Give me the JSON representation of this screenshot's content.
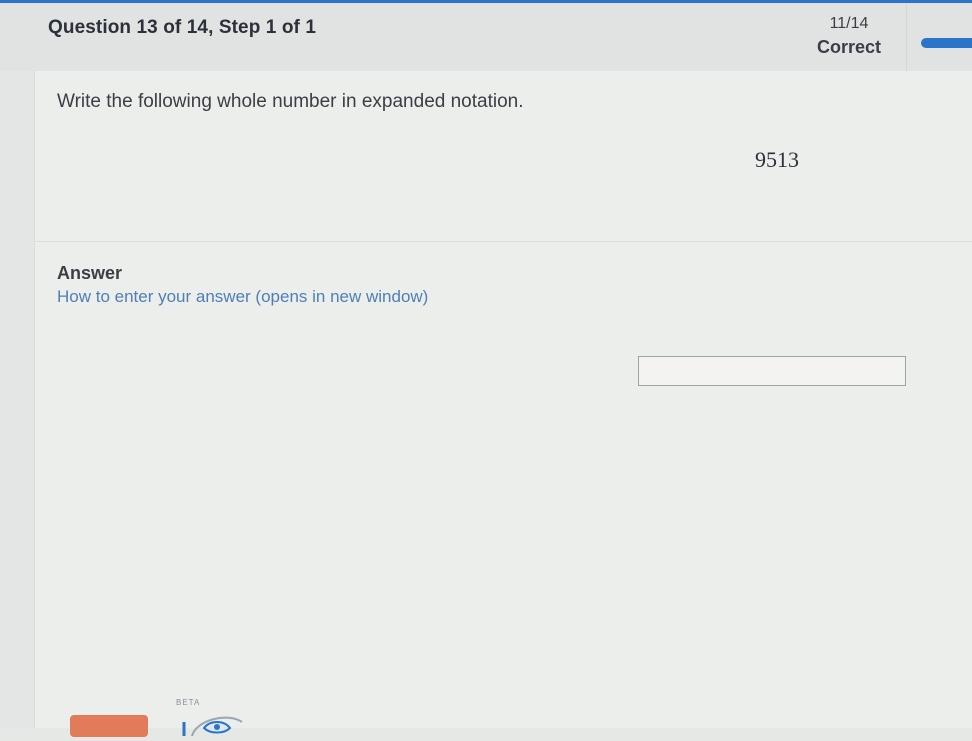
{
  "header": {
    "question_title": "Question 13 of 14,  Step 1 of 1",
    "score_fraction": "11/14",
    "score_status": "Correct",
    "progress": 0.79
  },
  "question": {
    "instruction": "Write the following whole number in expanded notation.",
    "number": "9513"
  },
  "answer": {
    "heading": "Answer",
    "help_link": "How to enter your answer (opens in new window)",
    "input_value": "",
    "input_placeholder": ""
  },
  "widget": {
    "beta_label": "BETA",
    "icon": "eye-icon"
  },
  "colors": {
    "accent": "#2a74c9",
    "link": "#4e7fb7",
    "submit": "#e27b59"
  }
}
